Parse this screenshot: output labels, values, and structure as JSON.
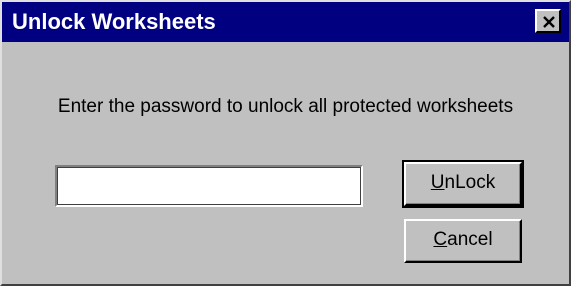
{
  "window": {
    "title": "Unlock Worksheets",
    "close_glyph": "close-icon"
  },
  "prompt": {
    "text": "Enter the password to unlock all protected worksheets"
  },
  "password_field": {
    "value": "",
    "placeholder": ""
  },
  "buttons": {
    "unlock": {
      "accel": "U",
      "rest": "nLock"
    },
    "cancel": {
      "accel": "C",
      "rest": "ancel"
    }
  },
  "colors": {
    "titlebar": "#000080",
    "face": "#c0c0c0"
  }
}
